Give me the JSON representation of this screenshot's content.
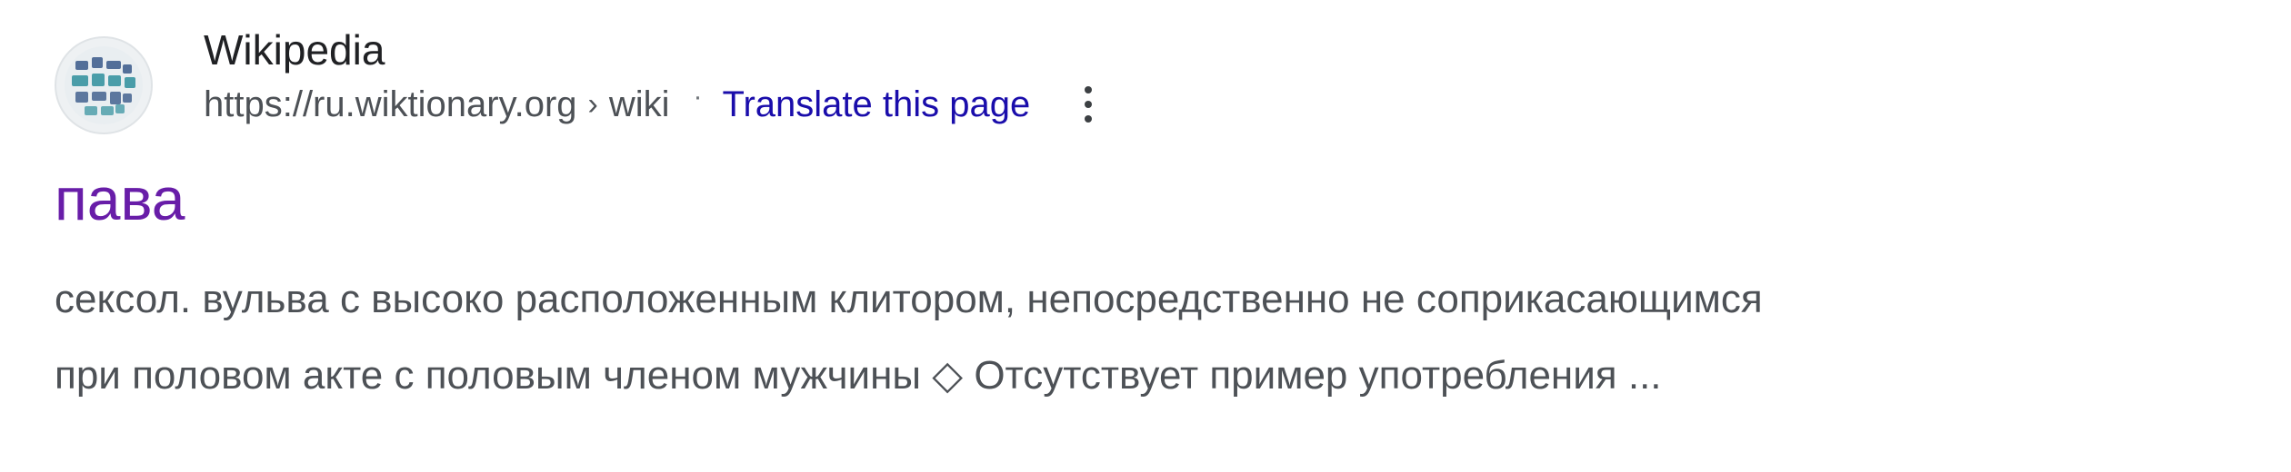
{
  "result": {
    "site_name": "Wikipedia",
    "favicon_icon": "wiktionary-logo-icon",
    "url": {
      "domain": "https://ru.wiktionary.org",
      "separator": "›",
      "path": "wiki"
    },
    "dot_separator": "·",
    "translate_link": "Translate this page",
    "more_options_icon": "vertical-ellipsis-icon",
    "title": "пава",
    "snippet_line_1": "сексол. вульва с высоко расположенным клитором, непосредственно не соприкасающимся",
    "snippet_line_2": "при половом акте с половым членом мужчины ◇ Отсутствует пример употребления ..."
  },
  "colors": {
    "title_visited": "#681da8",
    "link": "#1a0dab",
    "text": "#4d5156",
    "site_name": "#202124"
  }
}
